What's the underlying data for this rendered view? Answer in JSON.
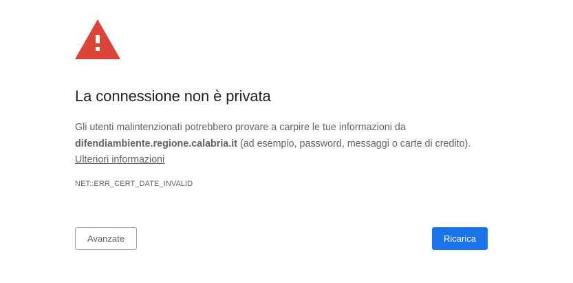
{
  "interstitial": {
    "icon": "warning-triangle-icon",
    "icon_color": "#db4437",
    "title": "La connessione non è privata",
    "explanation": {
      "intro": "Gli utenti malintenzionati potrebbero provare a carpire le tue informazioni da ",
      "host": "difendiambiente.regione.calabria.it",
      "outro": " (ad esempio, password, messaggi o carte di credito). ",
      "learn_more": "Ulteriori informazioni"
    },
    "error_code": "NET::ERR_CERT_DATE_INVALID"
  },
  "buttons": {
    "advanced_label": "Avanzate",
    "reload_label": "Ricarica",
    "primary_color": "#1a73e8"
  }
}
